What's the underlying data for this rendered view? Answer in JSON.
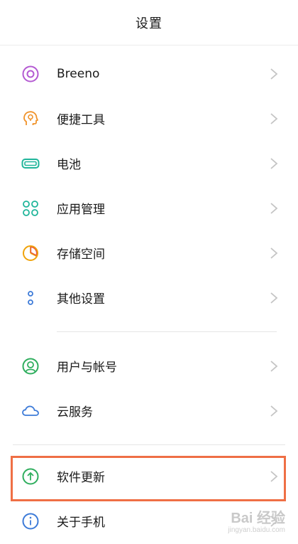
{
  "header": {
    "title": "设置"
  },
  "items": [
    {
      "label": "Breeno",
      "icon": "breeno-icon",
      "color": "#b45ad2"
    },
    {
      "label": "便捷工具",
      "icon": "head-bulb-icon",
      "color": "#f0932b"
    },
    {
      "label": "电池",
      "icon": "battery-icon",
      "color": "#1fb59a"
    },
    {
      "label": "应用管理",
      "icon": "app-grid-icon",
      "color": "#1fb59a"
    },
    {
      "label": "存储空间",
      "icon": "storage-pie-icon",
      "color": "#f0a30a"
    },
    {
      "label": "其他设置",
      "icon": "other-dots-icon",
      "color": "#3d7bd8"
    },
    {
      "label": "用户与帐号",
      "icon": "user-account-icon",
      "color": "#2fae5e"
    },
    {
      "label": "云服务",
      "icon": "cloud-icon",
      "color": "#3d7bd8"
    },
    {
      "label": "软件更新",
      "icon": "update-arrow-icon",
      "color": "#2fae5e"
    },
    {
      "label": "关于手机",
      "icon": "info-icon",
      "color": "#3d7bd8"
    }
  ],
  "highlight_color": "#ef6f45",
  "watermark": {
    "main": "Bai 经验",
    "sub": "jingyan.baidu.com"
  }
}
